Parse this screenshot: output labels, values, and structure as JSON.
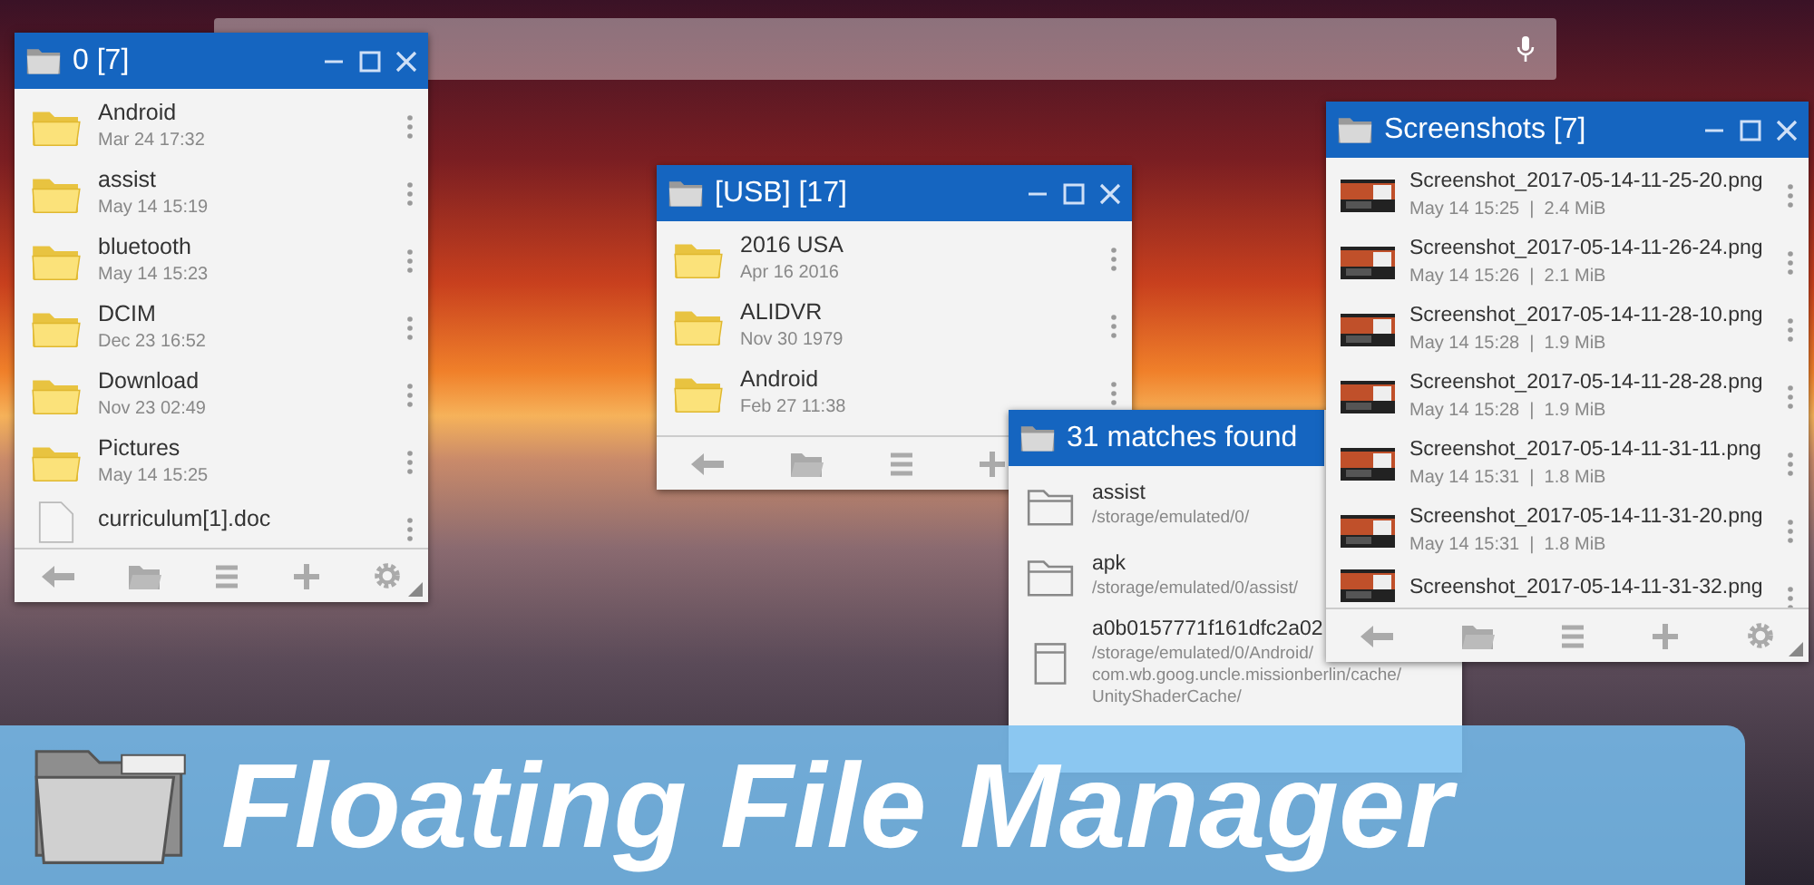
{
  "search_bar": {
    "mic": true
  },
  "windows": [
    {
      "title": "0 [7]",
      "window_controls": true,
      "toolbar": true,
      "rows": [
        {
          "kind": "folder",
          "name": "Android",
          "detail": "Mar 24 17:32"
        },
        {
          "kind": "folder",
          "name": "assist",
          "detail": "May 14 15:19"
        },
        {
          "kind": "folder",
          "name": "bluetooth",
          "detail": "May 14 15:23"
        },
        {
          "kind": "folder",
          "name": "DCIM",
          "detail": "Dec 23 16:52"
        },
        {
          "kind": "folder",
          "name": "Download",
          "detail": "Nov 23 02:49"
        },
        {
          "kind": "folder",
          "name": "Pictures",
          "detail": "May 14 15:25"
        },
        {
          "kind": "file",
          "name": "curriculum[1].doc"
        }
      ]
    },
    {
      "title": "[USB] [17]",
      "window_controls": true,
      "toolbar": true,
      "rows": [
        {
          "kind": "folder",
          "name": "2016 USA",
          "detail": "Apr 16 2016"
        },
        {
          "kind": "folder",
          "name": "ALIDVR",
          "detail": "Nov 30 1979"
        },
        {
          "kind": "folder",
          "name": "Android",
          "detail": "Feb 27 11:38"
        }
      ]
    },
    {
      "title": "31 matches found",
      "window_controls": false,
      "toolbar": false,
      "rows": [
        {
          "kind": "folder_outline",
          "name": "assist",
          "path_lines": [
            "/storage/emulated/0/"
          ]
        },
        {
          "kind": "folder_outline",
          "name": "apk",
          "path_lines": [
            "/storage/emulated/0/assist/"
          ]
        },
        {
          "kind": "file_outline",
          "name": "a0b0157771f161dfc2a02",
          "path_lines": [
            "/storage/emulated/0/Android/",
            "com.wb.goog.uncle.missionberlin/cache/",
            "UnityShaderCache/"
          ]
        }
      ]
    },
    {
      "title": "Screenshots [7]",
      "window_controls": true,
      "toolbar": true,
      "rows": [
        {
          "kind": "image",
          "name": "Screenshot_2017-05-14-11-25-20.png",
          "detail": "May 14 15:25  |  2.4 MiB"
        },
        {
          "kind": "image",
          "name": "Screenshot_2017-05-14-11-26-24.png",
          "detail": "May 14 15:26  |  2.1 MiB"
        },
        {
          "kind": "image",
          "name": "Screenshot_2017-05-14-11-28-10.png",
          "detail": "May 14 15:28  |  1.9 MiB"
        },
        {
          "kind": "image",
          "name": "Screenshot_2017-05-14-11-28-28.png",
          "detail": "May 14 15:28  |  1.9 MiB"
        },
        {
          "kind": "image",
          "name": "Screenshot_2017-05-14-11-31-11.png",
          "detail": "May 14 15:31  |  1.8 MiB"
        },
        {
          "kind": "image",
          "name": "Screenshot_2017-05-14-11-31-20.png",
          "detail": "May 14 15:31  |  1.8 MiB"
        },
        {
          "kind": "image",
          "name": "Screenshot_2017-05-14-11-31-32.png"
        }
      ]
    }
  ],
  "banner": {
    "title": "Floating File Manager"
  }
}
